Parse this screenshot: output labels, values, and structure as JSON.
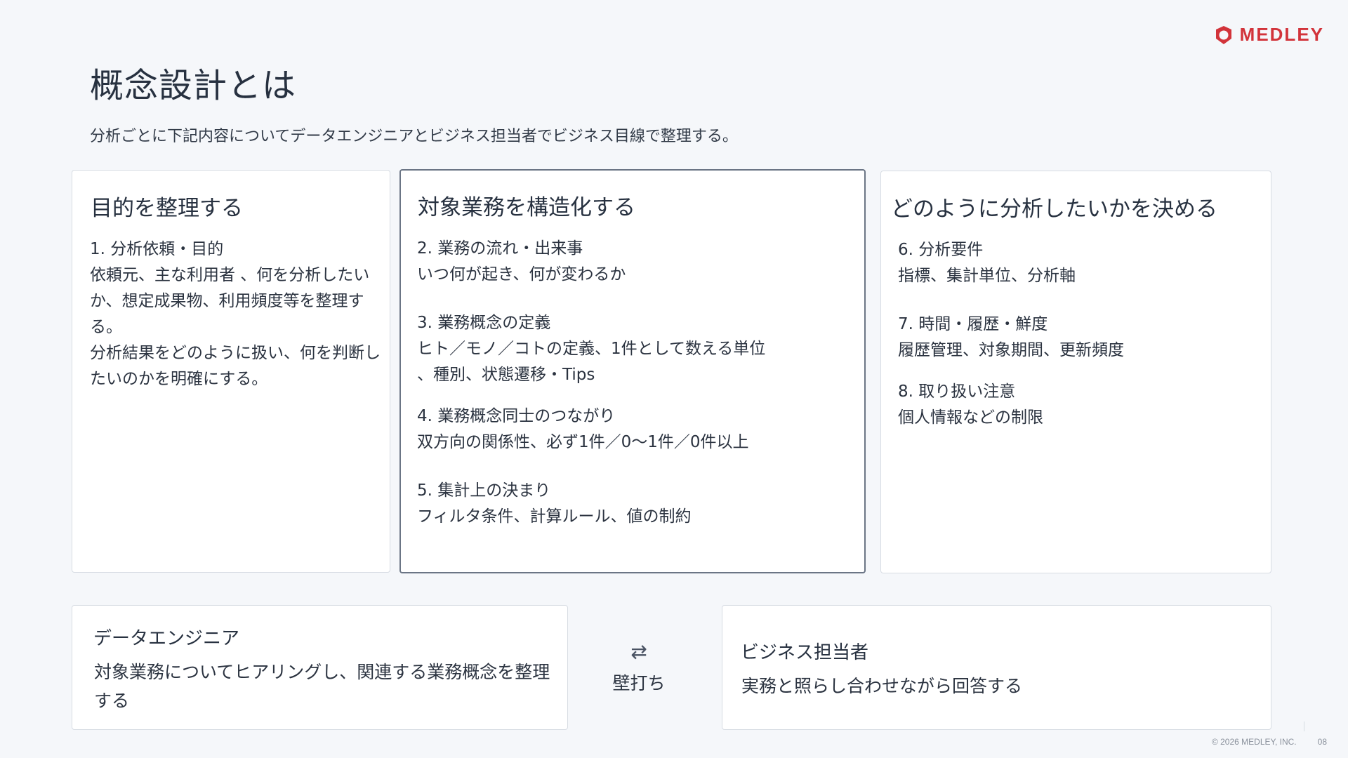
{
  "brand": {
    "name": "MEDLEY",
    "color": "#d2333a"
  },
  "slide": {
    "title": "概念設計とは",
    "subtitle": "分析ごとに下記内容についてデータエンジニアとビジネス担当者でビジネス目線で整理する。"
  },
  "columns": [
    {
      "title": "目的を整理する",
      "items": [
        {
          "heading": "1. 分析依頼・目的",
          "lines": [
            "依頼元、主な利用者 、何を分析したいか、想定成果物、利用頻度等を整理する。",
            "分析結果をどのように扱い、何を判断したいのかを明確にする。"
          ]
        }
      ]
    },
    {
      "title": "対象業務を構造化する",
      "items": [
        {
          "heading": "2. 業務の流れ・出来事",
          "lines": [
            "いつ何が起き、何が変わるか"
          ]
        },
        {
          "heading": "3. 業務概念の定義",
          "lines": [
            "ヒト／モノ／コトの定義、1件として数える単位",
            "、種別、状態遷移・Tips"
          ]
        },
        {
          "heading": "4. 業務概念同士のつながり",
          "lines": [
            "双方向の関係性、必ず1件／0〜1件／0件以上"
          ]
        },
        {
          "heading": "5. 集計上の決まり",
          "lines": [
            "フィルタ条件、計算ルール、値の制約"
          ]
        }
      ]
    },
    {
      "title": "どのように分析したいかを決める",
      "items": [
        {
          "heading": "6. 分析要件",
          "lines": [
            "指標、集計単位、分析軸"
          ]
        },
        {
          "heading": "7. 時間・履歴・鮮度",
          "lines": [
            "履歴管理、対象期間、更新頻度"
          ]
        },
        {
          "heading": "8. 取り扱い注意",
          "lines": [
            "個人情報などの制限"
          ]
        }
      ]
    }
  ],
  "roles": {
    "engineer": {
      "title": "データエンジニア",
      "description": "対象業務についてヒアリングし、関連する業務概念を整理する"
    },
    "exchange": {
      "icon": "⇄",
      "label": "壁打ち"
    },
    "business": {
      "title": "ビジネス担当者",
      "description": "実務と照らし合わせながら回答する"
    }
  },
  "footer": {
    "copyright": "© 2026 MEDLEY, INC.",
    "page": "08"
  }
}
